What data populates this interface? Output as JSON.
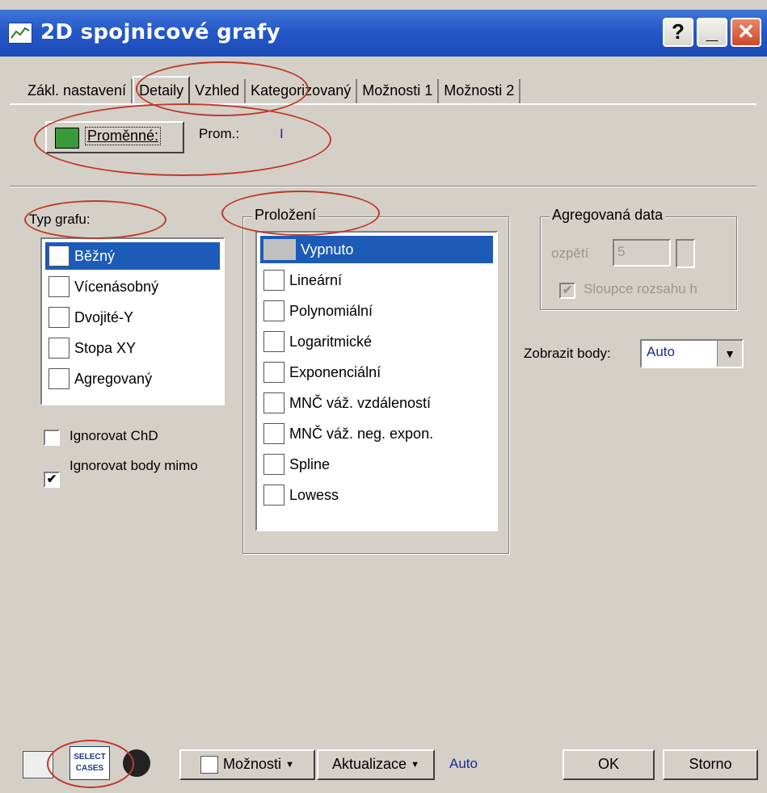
{
  "window": {
    "title": "2D spojnicové grafy",
    "help_label": "?",
    "minimize_label": "_",
    "close_label": "✕"
  },
  "tabs": [
    "Zákl. nastavení",
    "Detaily",
    "Vzhled",
    "Kategorizovaný",
    "Možnosti 1",
    "Možnosti 2"
  ],
  "active_tab": "Detaily",
  "variables": {
    "button_label": "Proměnné:",
    "prom_label": "Prom.:",
    "prom_value": "I"
  },
  "chart_type": {
    "label": "Typ grafu:",
    "items": [
      "Běžný",
      "Vícenásobný",
      "Dvojité-Y",
      "Stopa XY",
      "Agregovaný"
    ],
    "selected": "Běžný"
  },
  "fit": {
    "label": "Proložení",
    "items": [
      "Vypnuto",
      "Lineární",
      "Polynomiální",
      "Logaritmické",
      "Exponenciální",
      "MNČ váž. vzdáleností",
      "MNČ váž. neg. expon.",
      "Spline",
      "Lowess"
    ],
    "selected": "Vypnuto"
  },
  "options": {
    "ignore_md_label": "Ignorovat ChD",
    "ignore_md_checked": false,
    "ignore_outliers_label": "Ignorovat body mimo",
    "ignore_outliers_checked": true
  },
  "aggregated": {
    "label": "Agregovaná data",
    "range_label": "ozpětí",
    "range_value": "5",
    "columns_label": "Sloupce rozsahu h",
    "columns_checked": true
  },
  "show_points": {
    "label": "Zobrazit body:",
    "value": "Auto"
  },
  "bottom": {
    "select_cases_line1": "SELECT",
    "select_cases_line2": "CASES",
    "options_label": "Možnosti",
    "update_label": "Aktualizace",
    "update_value": "Auto",
    "ok_label": "OK",
    "cancel_label": "Storno"
  }
}
